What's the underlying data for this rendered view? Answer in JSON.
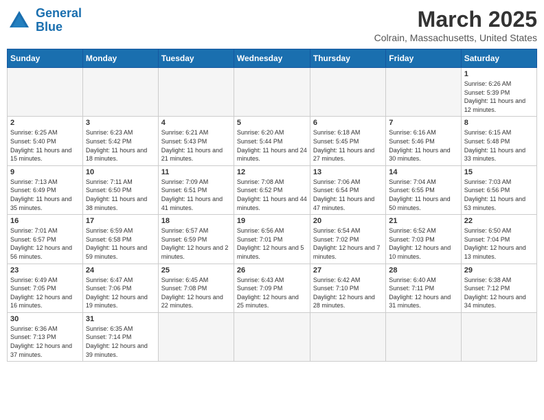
{
  "logo": {
    "text_general": "General",
    "text_blue": "Blue"
  },
  "title": "March 2025",
  "subtitle": "Colrain, Massachusetts, United States",
  "days_of_week": [
    "Sunday",
    "Monday",
    "Tuesday",
    "Wednesday",
    "Thursday",
    "Friday",
    "Saturday"
  ],
  "weeks": [
    [
      {
        "day": null
      },
      {
        "day": null
      },
      {
        "day": null
      },
      {
        "day": null
      },
      {
        "day": null
      },
      {
        "day": null
      },
      {
        "day": 1,
        "sunrise": "6:26 AM",
        "sunset": "5:39 PM",
        "daylight": "11 hours and 12 minutes."
      }
    ],
    [
      {
        "day": 2,
        "sunrise": "6:25 AM",
        "sunset": "5:40 PM",
        "daylight": "11 hours and 15 minutes."
      },
      {
        "day": 3,
        "sunrise": "6:23 AM",
        "sunset": "5:42 PM",
        "daylight": "11 hours and 18 minutes."
      },
      {
        "day": 4,
        "sunrise": "6:21 AM",
        "sunset": "5:43 PM",
        "daylight": "11 hours and 21 minutes."
      },
      {
        "day": 5,
        "sunrise": "6:20 AM",
        "sunset": "5:44 PM",
        "daylight": "11 hours and 24 minutes."
      },
      {
        "day": 6,
        "sunrise": "6:18 AM",
        "sunset": "5:45 PM",
        "daylight": "11 hours and 27 minutes."
      },
      {
        "day": 7,
        "sunrise": "6:16 AM",
        "sunset": "5:46 PM",
        "daylight": "11 hours and 30 minutes."
      },
      {
        "day": 8,
        "sunrise": "6:15 AM",
        "sunset": "5:48 PM",
        "daylight": "11 hours and 33 minutes."
      }
    ],
    [
      {
        "day": 9,
        "sunrise": "7:13 AM",
        "sunset": "6:49 PM",
        "daylight": "11 hours and 35 minutes."
      },
      {
        "day": 10,
        "sunrise": "7:11 AM",
        "sunset": "6:50 PM",
        "daylight": "11 hours and 38 minutes."
      },
      {
        "day": 11,
        "sunrise": "7:09 AM",
        "sunset": "6:51 PM",
        "daylight": "11 hours and 41 minutes."
      },
      {
        "day": 12,
        "sunrise": "7:08 AM",
        "sunset": "6:52 PM",
        "daylight": "11 hours and 44 minutes."
      },
      {
        "day": 13,
        "sunrise": "7:06 AM",
        "sunset": "6:54 PM",
        "daylight": "11 hours and 47 minutes."
      },
      {
        "day": 14,
        "sunrise": "7:04 AM",
        "sunset": "6:55 PM",
        "daylight": "11 hours and 50 minutes."
      },
      {
        "day": 15,
        "sunrise": "7:03 AM",
        "sunset": "6:56 PM",
        "daylight": "11 hours and 53 minutes."
      }
    ],
    [
      {
        "day": 16,
        "sunrise": "7:01 AM",
        "sunset": "6:57 PM",
        "daylight": "12 hours and 56 minutes."
      },
      {
        "day": 17,
        "sunrise": "6:59 AM",
        "sunset": "6:58 PM",
        "daylight": "11 hours and 59 minutes."
      },
      {
        "day": 18,
        "sunrise": "6:57 AM",
        "sunset": "6:59 PM",
        "daylight": "12 hours and 2 minutes."
      },
      {
        "day": 19,
        "sunrise": "6:56 AM",
        "sunset": "7:01 PM",
        "daylight": "12 hours and 5 minutes."
      },
      {
        "day": 20,
        "sunrise": "6:54 AM",
        "sunset": "7:02 PM",
        "daylight": "12 hours and 7 minutes."
      },
      {
        "day": 21,
        "sunrise": "6:52 AM",
        "sunset": "7:03 PM",
        "daylight": "12 hours and 10 minutes."
      },
      {
        "day": 22,
        "sunrise": "6:50 AM",
        "sunset": "7:04 PM",
        "daylight": "12 hours and 13 minutes."
      }
    ],
    [
      {
        "day": 23,
        "sunrise": "6:49 AM",
        "sunset": "7:05 PM",
        "daylight": "12 hours and 16 minutes."
      },
      {
        "day": 24,
        "sunrise": "6:47 AM",
        "sunset": "7:06 PM",
        "daylight": "12 hours and 19 minutes."
      },
      {
        "day": 25,
        "sunrise": "6:45 AM",
        "sunset": "7:08 PM",
        "daylight": "12 hours and 22 minutes."
      },
      {
        "day": 26,
        "sunrise": "6:43 AM",
        "sunset": "7:09 PM",
        "daylight": "12 hours and 25 minutes."
      },
      {
        "day": 27,
        "sunrise": "6:42 AM",
        "sunset": "7:10 PM",
        "daylight": "12 hours and 28 minutes."
      },
      {
        "day": 28,
        "sunrise": "6:40 AM",
        "sunset": "7:11 PM",
        "daylight": "12 hours and 31 minutes."
      },
      {
        "day": 29,
        "sunrise": "6:38 AM",
        "sunset": "7:12 PM",
        "daylight": "12 hours and 34 minutes."
      }
    ],
    [
      {
        "day": 30,
        "sunrise": "6:36 AM",
        "sunset": "7:13 PM",
        "daylight": "12 hours and 37 minutes."
      },
      {
        "day": 31,
        "sunrise": "6:35 AM",
        "sunset": "7:14 PM",
        "daylight": "12 hours and 39 minutes."
      },
      {
        "day": null
      },
      {
        "day": null
      },
      {
        "day": null
      },
      {
        "day": null
      },
      {
        "day": null
      }
    ]
  ]
}
